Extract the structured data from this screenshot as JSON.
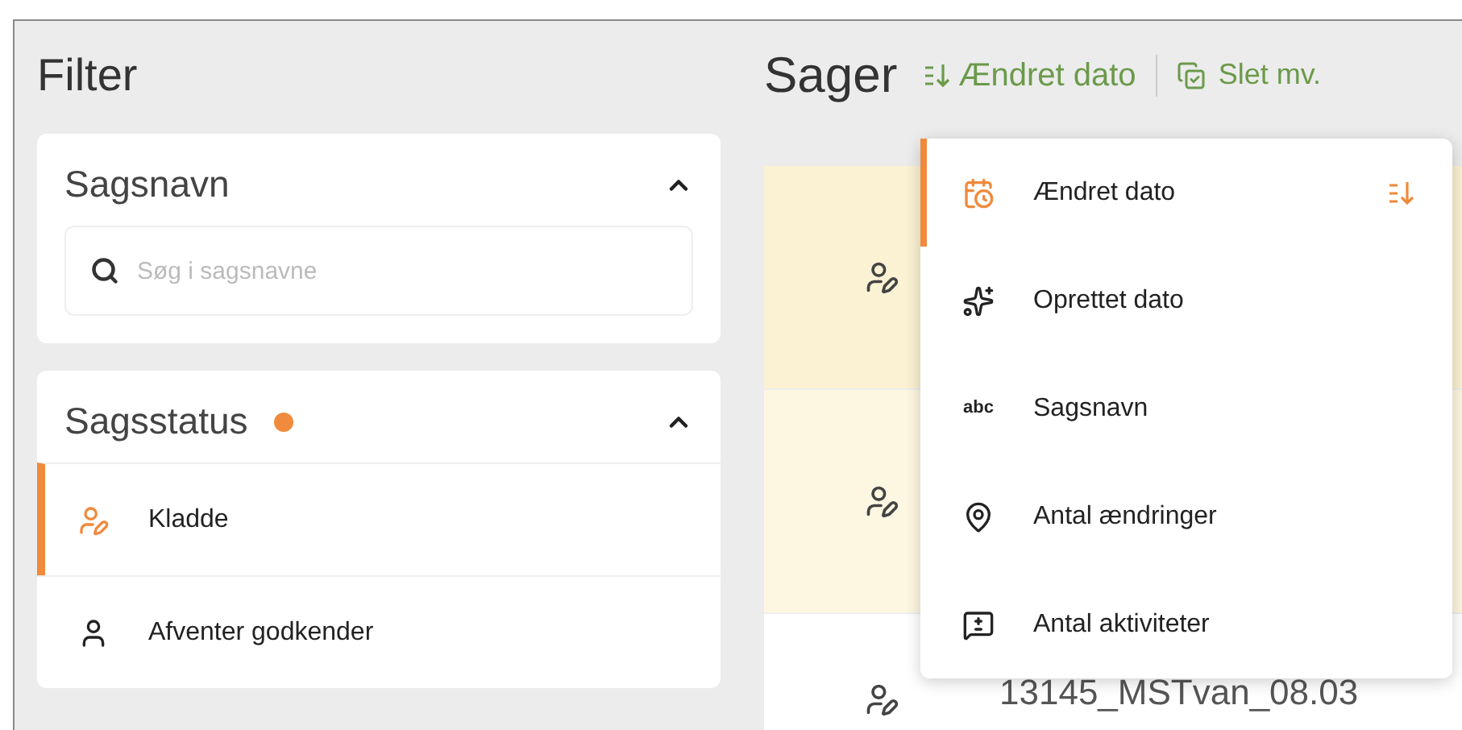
{
  "filter": {
    "title": "Filter",
    "sections": [
      {
        "kind": "search",
        "title": "Sagsnavn",
        "expanded": true,
        "placeholder": "Søg i sagsnavne"
      },
      {
        "kind": "status",
        "title": "Sagsstatus",
        "expanded": true,
        "color": "#f08a3c",
        "items": [
          {
            "label": "Kladde",
            "selected": true
          },
          {
            "label": "Afventer godkender",
            "selected": false
          }
        ]
      }
    ]
  },
  "main": {
    "title": "Sager",
    "sort_button": "Ændret dato",
    "delete_button": "Slet mv.",
    "rows": [
      {
        "color": "#fbf2d3"
      },
      {
        "color": "#fdf7e1"
      },
      {
        "color": "#ffffff",
        "text": "13145_MSTvan_08.03"
      }
    ]
  },
  "sort_menu": {
    "items": [
      {
        "kind": "calendar",
        "label": "Ændret dato",
        "selected": true
      },
      {
        "kind": "sparkles",
        "label": "Oprettet dato",
        "selected": false
      },
      {
        "kind": "abc",
        "label": "Sagsnavn",
        "selected": false
      },
      {
        "kind": "pin",
        "label": "Antal ændringer",
        "selected": false
      },
      {
        "kind": "comment",
        "label": "Antal aktiviteter",
        "selected": false
      }
    ]
  }
}
